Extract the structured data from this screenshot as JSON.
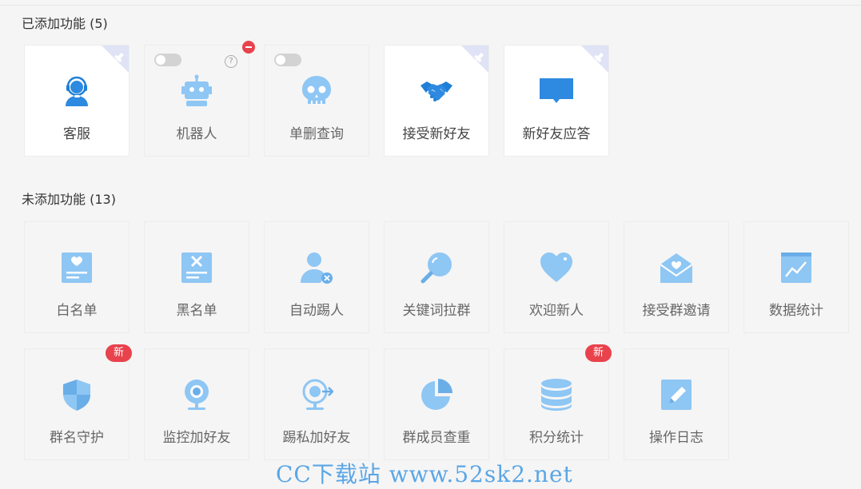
{
  "added": {
    "title": "已添加功能 (5)",
    "items": [
      {
        "label": "客服",
        "icon": "customer-service-icon"
      },
      {
        "label": "机器人",
        "icon": "robot-icon",
        "help": "?"
      },
      {
        "label": "单删查询",
        "icon": "skull-icon"
      },
      {
        "label": "接受新好友",
        "icon": "handshake-icon"
      },
      {
        "label": "新好友应答",
        "icon": "chat-bubble-icon"
      }
    ]
  },
  "not_added": {
    "title": "未添加功能 (13)",
    "items": [
      {
        "label": "白名单",
        "icon": "whitelist-icon"
      },
      {
        "label": "黑名单",
        "icon": "blacklist-icon"
      },
      {
        "label": "自动踢人",
        "icon": "kick-user-icon"
      },
      {
        "label": "关键词拉群",
        "icon": "search-icon"
      },
      {
        "label": "欢迎新人",
        "icon": "heart-icon"
      },
      {
        "label": "接受群邀请",
        "icon": "mail-heart-icon"
      },
      {
        "label": "数据统计",
        "icon": "chart-icon"
      },
      {
        "label": "群名守护",
        "icon": "shield-icon",
        "badge": "新"
      },
      {
        "label": "监控加好友",
        "icon": "webcam-icon"
      },
      {
        "label": "踢私加好友",
        "icon": "webcam-arrow-icon"
      },
      {
        "label": "群成员查重",
        "icon": "pie-chart-icon"
      },
      {
        "label": "积分统计",
        "icon": "database-icon",
        "badge": "新"
      },
      {
        "label": "操作日志",
        "icon": "edit-log-icon"
      }
    ]
  },
  "watermark": "CC下载站 www.52sk2.net",
  "colors": {
    "primary": "#2d8ae0",
    "light": "#8ec6f4",
    "badge": "#e8424c"
  }
}
